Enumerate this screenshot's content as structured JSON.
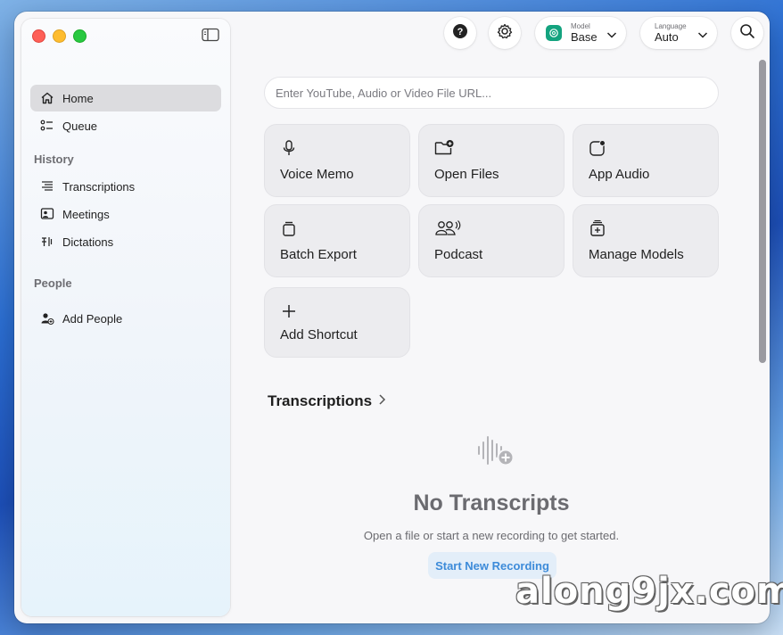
{
  "sidebar": {
    "nav": [
      {
        "label": "Home",
        "icon": "home-icon"
      },
      {
        "label": "Queue",
        "icon": "queue-icon"
      }
    ],
    "history_label": "History",
    "history": [
      {
        "label": "Transcriptions",
        "icon": "transcriptions-icon"
      },
      {
        "label": "Meetings",
        "icon": "meetings-icon"
      },
      {
        "label": "Dictations",
        "icon": "dictations-icon"
      }
    ],
    "people_label": "People",
    "people": [
      {
        "label": "Add People",
        "icon": "add-person-icon"
      }
    ]
  },
  "toolbar": {
    "model": {
      "label": "Model",
      "value": "Base"
    },
    "language": {
      "label": "Language",
      "value": "Auto"
    }
  },
  "url_input": {
    "placeholder": "Enter YouTube, Audio or Video File URL..."
  },
  "actions": [
    {
      "label": "Voice Memo",
      "icon": "microphone-icon"
    },
    {
      "label": "Open Files",
      "icon": "folder-add-icon"
    },
    {
      "label": "App Audio",
      "icon": "app-audio-icon"
    },
    {
      "label": "Batch Export",
      "icon": "batch-export-icon"
    },
    {
      "label": "Podcast",
      "icon": "podcast-icon"
    },
    {
      "label": "Manage Models",
      "icon": "manage-models-icon"
    },
    {
      "label": "Add Shortcut",
      "icon": "plus-icon"
    }
  ],
  "transcriptions": {
    "title": "Transcriptions",
    "empty_title": "No Transcripts",
    "empty_subtitle": "Open a file or start a new recording to get started.",
    "start_label": "Start New Recording"
  },
  "watermark": "along9jx.com",
  "colors": {
    "accent": "#3d8bd9",
    "active_nav": "#dcdcdf"
  }
}
